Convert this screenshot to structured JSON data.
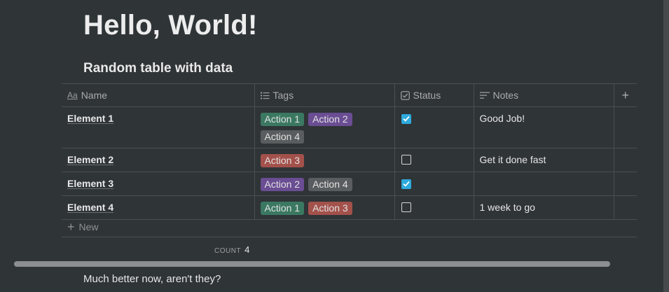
{
  "page": {
    "title": "Hello, World!",
    "footer_text": "Much better now, aren't they?"
  },
  "database": {
    "title": "Random table with data",
    "columns": [
      {
        "label": "Name",
        "icon": "text-aa-icon"
      },
      {
        "label": "Tags",
        "icon": "list-icon"
      },
      {
        "label": "Status",
        "icon": "checkbox-icon"
      },
      {
        "label": "Notes",
        "icon": "text-lines-icon"
      }
    ],
    "add_column_label": "+",
    "rows": [
      {
        "name": "Element 1",
        "tags": [
          {
            "label": "Action 1",
            "color": "#3b7862"
          },
          {
            "label": "Action 2",
            "color": "#6a4d93"
          },
          {
            "label": "Action 4",
            "color": "#5a5d5f"
          }
        ],
        "status": true,
        "notes": "Good Job!"
      },
      {
        "name": "Element 2",
        "tags": [
          {
            "label": "Action 3",
            "color": "#a3514b"
          }
        ],
        "status": false,
        "notes": "Get it done fast"
      },
      {
        "name": "Element 3",
        "tags": [
          {
            "label": "Action 2",
            "color": "#6a4d93"
          },
          {
            "label": "Action 4",
            "color": "#5a5d5f"
          }
        ],
        "status": true,
        "notes": ""
      },
      {
        "name": "Element 4",
        "tags": [
          {
            "label": "Action 1",
            "color": "#3b7862"
          },
          {
            "label": "Action 3",
            "color": "#a3514b"
          }
        ],
        "status": false,
        "notes": "1 week to go"
      }
    ],
    "new_label": "New",
    "count_label": "COUNT",
    "count_value": "4"
  },
  "colors": {
    "background": "#2f3437",
    "checkbox_checked": "#2eaadc",
    "tag_green": "#3b7862",
    "tag_purple": "#6a4d93",
    "tag_gray": "#5a5d5f",
    "tag_red": "#a3514b"
  }
}
